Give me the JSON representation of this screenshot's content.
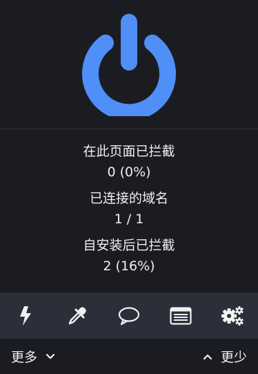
{
  "power": {
    "icon": "power-icon",
    "color": "#4f8ff7"
  },
  "stats": {
    "blocked_on_page_label": "在此页面已拦截",
    "blocked_on_page_value": "0 (0%)",
    "domains_connected_label": "已连接的域名",
    "domains_connected_value": "1 / 1",
    "blocked_since_install_label": "自安装后已拦截",
    "blocked_since_install_value": "2 (16%)"
  },
  "toolbar": {
    "icons": [
      "lightning-icon",
      "eyedropper-icon",
      "speech-bubble-icon",
      "element-list-icon",
      "gears-icon"
    ]
  },
  "footer": {
    "more_label": "更多",
    "less_label": "更少"
  }
}
